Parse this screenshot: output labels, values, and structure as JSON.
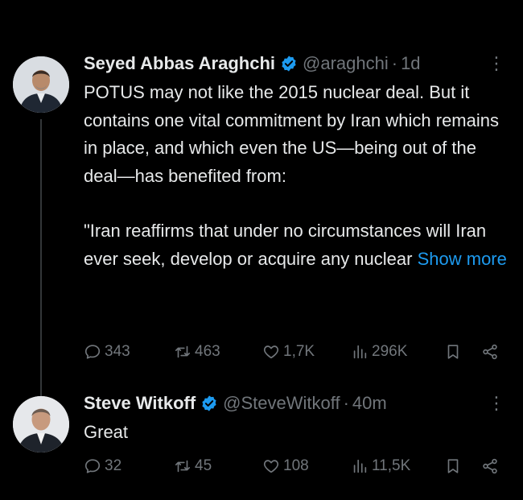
{
  "tweets": [
    {
      "author_name": "Seyed Abbas Araghchi",
      "handle": "@araghchi",
      "separator": "·",
      "time": "1d",
      "more": "⋮",
      "paragraphs": [
        "POTUS may not like the 2015 nuclear deal. But it contains one vital commitment by Iran which remains in place, and which even the US—being out of the deal—has benefited from:",
        "\"Iran reaffirms that under no circumstances will Iran ever seek, develop or acquire any nuclear"
      ],
      "show_more": "Show more",
      "replies": "343",
      "reposts": "463",
      "likes": "1,7K",
      "views": "296K",
      "avatar_icon": "avatar-portrait-icon",
      "verified_color": "#1d9bf0"
    },
    {
      "author_name": "Steve Witkoff",
      "handle": "@SteveWitkoff",
      "separator": "·",
      "time": "40m",
      "more": "⋮",
      "text": "Great",
      "replies": "32",
      "reposts": "45",
      "likes": "108",
      "views": "11,5K",
      "avatar_icon": "avatar-portrait-icon",
      "verified_color": "#1d9bf0"
    }
  ],
  "colors": {
    "background": "#000000",
    "text": "#e7e9ea",
    "muted": "#71767b",
    "link": "#1d9bf0"
  }
}
